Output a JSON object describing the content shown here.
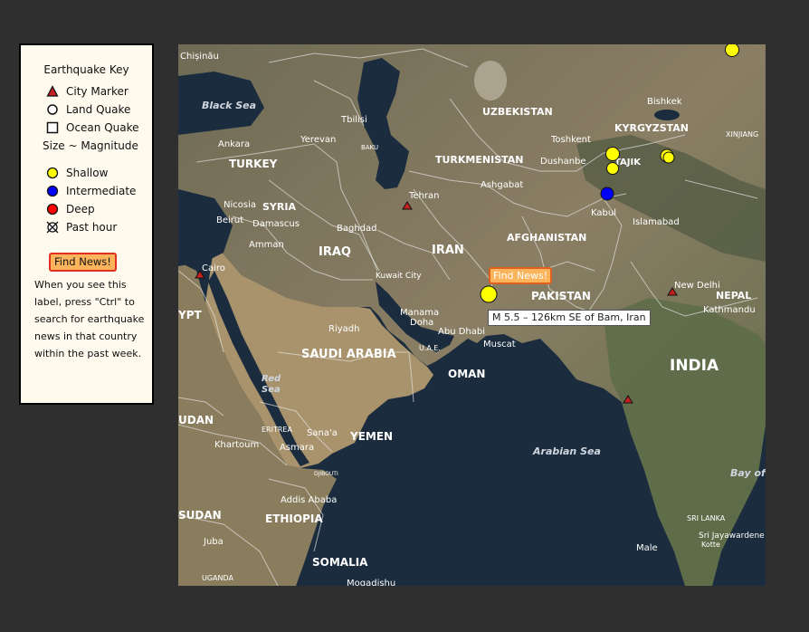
{
  "legend": {
    "title": "Earthquake Key",
    "items": [
      {
        "label": "City Marker",
        "icon": "triangle-marker-icon"
      },
      {
        "label": "Land Quake",
        "icon": "circle-outline-icon"
      },
      {
        "label": "Ocean Quake",
        "icon": "square-outline-icon"
      }
    ],
    "size_label": "Size ~ Magnitude",
    "depth_items": [
      {
        "label": "Shallow",
        "color": "#ffff00"
      },
      {
        "label": "Intermediate",
        "color": "#0000ff"
      },
      {
        "label": "Deep",
        "color": "#ff0000"
      },
      {
        "label": "Past hour",
        "color": "#ffffff"
      }
    ],
    "find_news_label": "Find News!",
    "help_text": "When you see this label, press \"Ctrl\" to search for earthquake news in that country within the past week."
  },
  "map": {
    "popup_button": "Find News!",
    "tooltip": "M 5.5 – 126km SE of Bam, Iran",
    "colors": {
      "shallow": "#ffff00",
      "intermediate": "#0000ff",
      "city_marker": "#c42020"
    },
    "labels": {
      "chisinau": "Chișinău",
      "black_sea": "Black Sea",
      "uzbekistan": "UZBEKISTAN",
      "bishkek": "Bishkek",
      "kyrgyzstan": "KYRGYZSTAN",
      "xinjiang": "XINJIANG",
      "tbilisi": "Tbilisi",
      "ankara": "Ankara",
      "yerevan": "Yerevan",
      "baku": "BAKU",
      "tashkent": "Toshkent",
      "turkey": "TURKEY",
      "turkmenistan": "TURKMENISTAN",
      "dushanbe": "Dushanbe",
      "tajik": "TAJIK",
      "ashgabat": "Ashgabat",
      "nicosia": "Nicosia",
      "syria": "SYRIA",
      "tehran": "Tehran",
      "beirut": "Beirut",
      "damascus": "Damascus",
      "baghdad": "Baghdad",
      "kabul": "Kabul",
      "islamabad": "Islamabad",
      "amman": "Amman",
      "afghanistan": "AFGHANISTAN",
      "iraq": "IRAQ",
      "iran": "IRAN",
      "cairo": "Cairo",
      "kuwait": "Kuwait City",
      "new_delhi": "New Delhi",
      "egypt": "YPT",
      "pakistan": "PAKISTAN",
      "nepal": "NEPAL",
      "manama": "Manama",
      "doha": "Doha",
      "kathmandu": "Kathmandu",
      "riyadh": "Riyadh",
      "abu_dhabi": "Abu Dhabi",
      "muscat": "Muscat",
      "uae": "U.A.E.",
      "saudi_arabia": "SAUDI ARABIA",
      "india": "INDIA",
      "oman": "OMAN",
      "red_sea_1": "Red",
      "red_sea_2": "Sea",
      "sudan": "UDAN",
      "eritrea": "ERITREA",
      "sanaa": "Sana'a",
      "khartoum": "Khartoum",
      "asmara": "Asmara",
      "yemen": "YEMEN",
      "arabian_sea": "Arabian Sea",
      "bay_of": "Bay of",
      "djibouti": "DJIBOUTI",
      "addis_ababa": "Addis Ababa",
      "south_sudan": "SUDAN",
      "ethiopia": "ETHIOPIA",
      "sri_lanka": "SRI LANKA",
      "sri_jayawardene": "Sri Jayawardene",
      "kotte": "Kotte",
      "juba": "Juba",
      "male": "Male",
      "somalia": "SOMALIA",
      "uganda": "UGANDA",
      "mogadishu": "Mogadishu"
    }
  }
}
